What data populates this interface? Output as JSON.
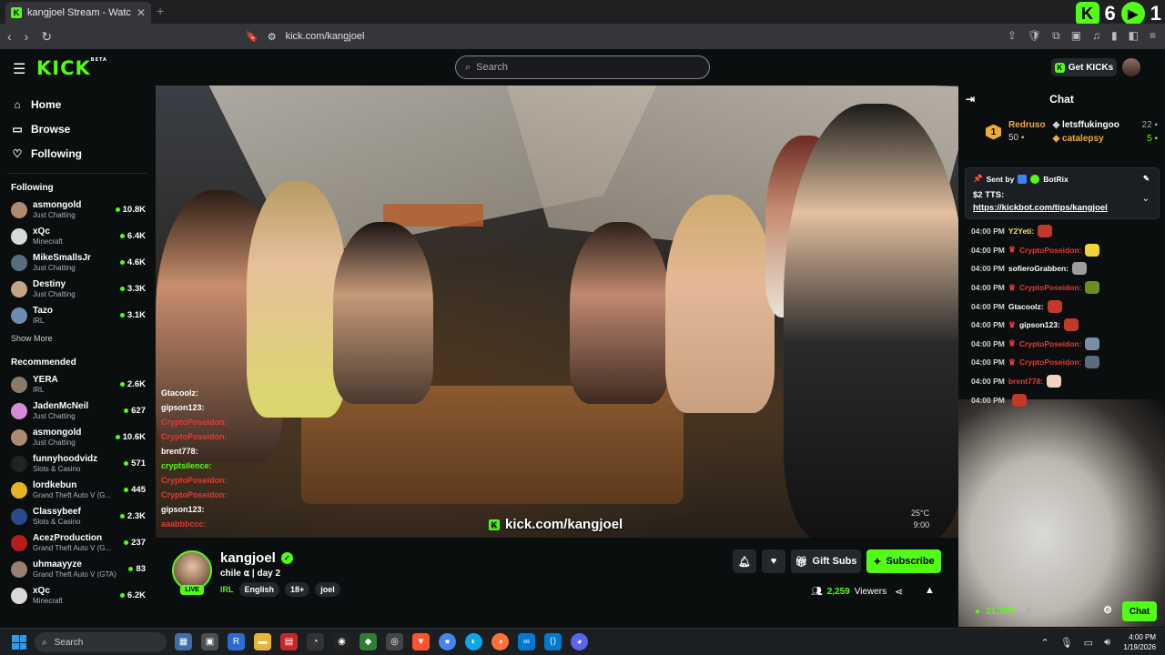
{
  "browser": {
    "tab_title": "kangjoel Stream - Watch Live",
    "url": "kick.com/kangjoel",
    "overlay_counts": [
      "6",
      "1"
    ]
  },
  "header": {
    "logo": "KICK",
    "logo_sup": "BETA",
    "search_placeholder": "Search",
    "get_kicks": "Get KICKs"
  },
  "sidebar": {
    "nav": [
      {
        "label": "Home",
        "icon": "home-icon"
      },
      {
        "label": "Browse",
        "icon": "browse-icon"
      },
      {
        "label": "Following",
        "icon": "heart-icon"
      }
    ],
    "following_heading": "Following",
    "following": [
      {
        "name": "asmongold",
        "category": "Just Chatting",
        "viewers": "10.8K",
        "color": "#b08a70"
      },
      {
        "name": "xQc",
        "category": "Minecraft",
        "viewers": "6.4K",
        "color": "#d9d9d9"
      },
      {
        "name": "MikeSmallsJr",
        "category": "Just Chatting",
        "viewers": "4.6K",
        "color": "#5a6d7e"
      },
      {
        "name": "Destiny",
        "category": "Just Chatting",
        "viewers": "3.3K",
        "color": "#c4a484"
      },
      {
        "name": "Tazo",
        "category": "IRL",
        "viewers": "3.1K",
        "color": "#6d8ab0"
      }
    ],
    "show_more": "Show More",
    "recommended_heading": "Recommended",
    "recommended": [
      {
        "name": "YERA",
        "category": "IRL",
        "viewers": "2.6K",
        "color": "#8a7a6a"
      },
      {
        "name": "JadenMcNeil",
        "category": "Just Chatting",
        "viewers": "627",
        "color": "#d48ad6"
      },
      {
        "name": "asmongold",
        "category": "Just Chatting",
        "viewers": "10.6K",
        "color": "#b08a70"
      },
      {
        "name": "funnyhoodvidz",
        "category": "Slots & Casino",
        "viewers": "571",
        "color": "#222222"
      },
      {
        "name": "lordkebun",
        "category": "Grand Theft Auto V (G...",
        "viewers": "445",
        "color": "#e6b422"
      },
      {
        "name": "Classybeef",
        "category": "Slots & Casino",
        "viewers": "2.3K",
        "color": "#2a4a8a"
      },
      {
        "name": "AcezProduction",
        "category": "Grand Theft Auto V (G...",
        "viewers": "237",
        "color": "#b71c1c"
      },
      {
        "name": "uhmaayyze",
        "category": "Grand Theft Auto V (GTA)",
        "viewers": "83",
        "color": "#9a8070"
      },
      {
        "name": "xQc",
        "category": "Minecraft",
        "viewers": "6.2K",
        "color": "#d9d9d9"
      }
    ]
  },
  "video": {
    "watermark": "kick.com/kangjoel",
    "temp": "25°C",
    "time": "9:00",
    "overlay_chat": [
      {
        "user": "Gtacoolz:",
        "color": "#ffffff"
      },
      {
        "user": "gipson123:",
        "color": "#ffffff"
      },
      {
        "user": "CryptoPoseidon:",
        "color": "#e53935"
      },
      {
        "user": "CryptoPoseidon:",
        "color": "#e53935"
      },
      {
        "user": "brent778:",
        "color": "#ffffff"
      },
      {
        "user": "cryptsilence:",
        "color": "#53fc18"
      },
      {
        "user": "CryptoPoseidon:",
        "color": "#e53935"
      },
      {
        "user": "CryptoPoseidon:",
        "color": "#e53935"
      },
      {
        "user": "gipson123:",
        "color": "#ffffff"
      },
      {
        "user": "aaabbbccc:",
        "color": "#e53935"
      }
    ]
  },
  "stream": {
    "name": "kangjoel",
    "title": "chile ⍺ | day 2",
    "category": "IRL",
    "tags": [
      "English",
      "18+",
      "joel"
    ],
    "live": "LIVE",
    "gift_subs": "Gift Subs",
    "subscribe": "Subscribe",
    "viewers": "2,259",
    "viewers_label": "Viewers"
  },
  "chat": {
    "title": "Chat",
    "leaderboard": [
      {
        "rank": "1",
        "name": "Redruso",
        "value": "50"
      },
      {
        "name": "letsffukingoo",
        "value": "22"
      },
      {
        "name": "catalepsy",
        "value": "5"
      }
    ],
    "pinned_sender_prefix": "Sent by",
    "pinned_sender": "BotRix",
    "pinned_message": "$2 TTS:",
    "pinned_link": "https://kickbot.com/tips/kangjoel",
    "messages": [
      {
        "time": "04:00 PM",
        "user": "Y2Yeti:",
        "color": "#e8e86a",
        "crown": false,
        "emote": "#c0392b"
      },
      {
        "time": "04:00 PM",
        "user": "CryptoPoseidon:",
        "color": "#e53935",
        "crown": true,
        "emote": "#f1d33a"
      },
      {
        "time": "04:00 PM",
        "user": "sofieroGrabben:",
        "color": "#ffffff",
        "crown": false,
        "emote": "#9e9e9e"
      },
      {
        "time": "04:00 PM",
        "user": "CryptoPoseidon:",
        "color": "#e53935",
        "crown": true,
        "emote": "#6b8e23"
      },
      {
        "time": "04:00 PM",
        "user": "Gtacoolz:",
        "color": "#ffffff",
        "crown": false,
        "emote": "#c0392b"
      },
      {
        "time": "04:00 PM",
        "user": "gipson123:",
        "color": "#ffffff",
        "crown": true,
        "emote": "#c0392b"
      },
      {
        "time": "04:00 PM",
        "user": "CryptoPoseidon:",
        "color": "#e53935",
        "crown": true,
        "emote": "#7a8ea8"
      },
      {
        "time": "04:00 PM",
        "user": "CryptoPoseidon:",
        "color": "#e53935",
        "crown": true,
        "emote": "#5a6d7e"
      },
      {
        "time": "04:00 PM",
        "user": "brent778:",
        "color": "#e53935",
        "crown": false,
        "emote": "#f3d3c1"
      },
      {
        "time": "04:00 PM",
        "user": "",
        "color": "#e53935",
        "crown": false,
        "emote": "#c0392b"
      }
    ],
    "kicks_total": "31,700",
    "kicks_other": "0",
    "chat_button": "Chat"
  },
  "taskbar": {
    "search": "Search",
    "time": "4:00 PM",
    "date": "1/19/2026"
  }
}
